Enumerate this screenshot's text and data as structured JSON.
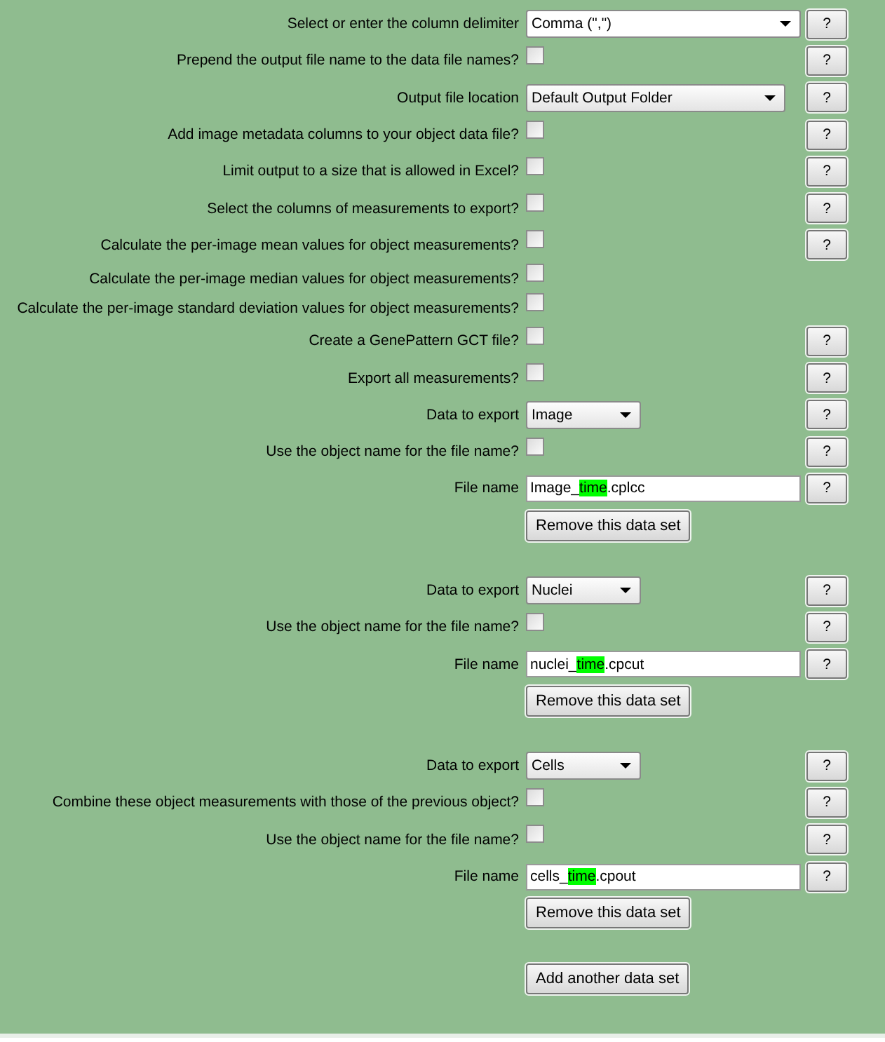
{
  "general": [
    {
      "kind": "dropdown",
      "label": "Select or enter the column delimiter",
      "value": "Comma (\",\")",
      "help": "?"
    },
    {
      "kind": "checkbox",
      "label": "Prepend the output file name to the data file names?",
      "checked": false,
      "help": "?"
    },
    {
      "kind": "dropdown",
      "label": "Output file location",
      "value": "Default Output Folder",
      "help": "?"
    },
    {
      "kind": "checkbox",
      "label": "Add image metadata columns to your object data file?",
      "checked": false,
      "help": "?"
    },
    {
      "kind": "checkbox",
      "label": "Limit output to a size that is allowed in Excel?",
      "checked": false,
      "help": "?"
    },
    {
      "kind": "checkbox",
      "label": "Select the columns of measurements to export?",
      "checked": false,
      "help": "?"
    },
    {
      "kind": "checkbox",
      "label": "Calculate the per-image mean values for object measurements?",
      "checked": false,
      "help": "?"
    },
    {
      "kind": "checkbox",
      "label": "Calculate the per-image median values for object measurements?",
      "checked": false
    },
    {
      "kind": "checkbox",
      "label": "Calculate the per-image standard deviation values for object measurements?",
      "checked": false
    },
    {
      "kind": "checkbox",
      "label": "Create a GenePattern GCT file?",
      "checked": false,
      "help": "?"
    },
    {
      "kind": "checkbox",
      "label": "Export all measurements?",
      "checked": false,
      "help": "?"
    }
  ],
  "data_sets": [
    {
      "rows": [
        {
          "kind": "dropdown",
          "label": "Data to export",
          "value": "Image",
          "help": "?"
        },
        {
          "kind": "checkbox",
          "label": "Use the object name for the file name?",
          "checked": false,
          "help": "?"
        },
        {
          "kind": "filename",
          "label": "File name",
          "prefix": "Image_",
          "token": "time",
          "suffix": ".cplcc",
          "help": "?"
        }
      ],
      "remove_button": "Remove this data set"
    },
    {
      "rows": [
        {
          "kind": "dropdown",
          "label": "Data to export",
          "value": "Nuclei",
          "help": "?"
        },
        {
          "kind": "checkbox",
          "label": "Use the object name for the file name?",
          "checked": false,
          "help": "?"
        },
        {
          "kind": "filename",
          "label": "File name",
          "prefix": "nuclei_",
          "token": "time",
          "suffix": ".cpcut",
          "help": "?"
        }
      ],
      "remove_button": "Remove this data set"
    },
    {
      "rows": [
        {
          "kind": "dropdown",
          "label": "Data to export",
          "value": "Cells",
          "help": "?"
        },
        {
          "kind": "checkbox",
          "label": "Combine these object measurements with those of the previous object?",
          "checked": false,
          "help": "?"
        },
        {
          "kind": "checkbox",
          "label": "Use the object name for the file name?",
          "checked": false,
          "help": "?"
        },
        {
          "kind": "filename",
          "label": "File name",
          "prefix": "cells_",
          "token": "time",
          "suffix": ".cpout",
          "help": "?"
        }
      ],
      "remove_button": "Remove this data set"
    }
  ],
  "add_button": "Add another data set"
}
